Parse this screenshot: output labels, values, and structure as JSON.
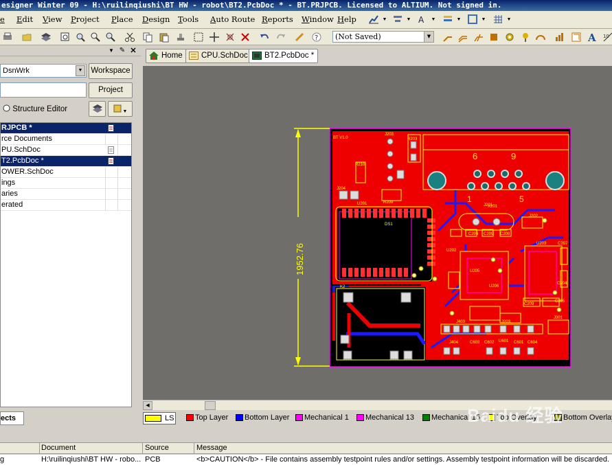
{
  "window": {
    "title": "esigner Winter 09 - H:\\ruilinqiushi\\BT HW - robot\\BT2.PcbDoc * - BT.PRJPCB. Licensed to ALTIUM. Not signed in."
  },
  "menu": {
    "items": [
      "Edit",
      "View",
      "Project",
      "Place",
      "Design",
      "Tools",
      "Auto Route",
      "Reports",
      "Window",
      "Help"
    ],
    "file_fragment": "e"
  },
  "toolbar": {
    "variant_value": "(Not Saved)"
  },
  "left_panel": {
    "workspace_combo": "DsnWrk",
    "workspace_button": "Workspace",
    "project_button": "Project",
    "structure_editor": "Structure Editor",
    "tree": [
      {
        "label": "RJPCB *",
        "state": "selected-bold"
      },
      {
        "label": "rce Documents",
        "state": "normal"
      },
      {
        "label": "PU.SchDoc",
        "state": "normal"
      },
      {
        "label": "T2.PcbDoc *",
        "state": "selected"
      },
      {
        "label": "OWER.SchDoc",
        "state": "normal"
      },
      {
        "label": "ings",
        "state": "normal"
      },
      {
        "label": "aries",
        "state": "normal"
      },
      {
        "label": "erated",
        "state": "normal"
      }
    ],
    "bottom_tab": "ects"
  },
  "doc_tabs": [
    {
      "label": "Home",
      "icon": "home-icon"
    },
    {
      "label": "CPU.SchDoc",
      "icon": "schematic-icon"
    },
    {
      "label": "BT2.PcbDoc *",
      "icon": "pcb-icon"
    }
  ],
  "pcb": {
    "dimension_label": "1952.76",
    "board_text": "BT V1.0",
    "connector_numbers": [
      "6",
      "9",
      "1",
      "5"
    ],
    "designators": [
      "J203",
      "R203",
      "J204",
      "R210",
      "R209",
      "U201",
      "DS1",
      "K2",
      "X201",
      "J202",
      "U202",
      "C206",
      "C209",
      "C208",
      "U203",
      "U205",
      "U206",
      "C204",
      "C205",
      "C207",
      "J201",
      "J301",
      "C209",
      "J403",
      "J404",
      "C603",
      "C602",
      "U601",
      "C601",
      "C604",
      "J203"
    ]
  },
  "layers": [
    {
      "label": "LS",
      "color": "#ffff00"
    },
    {
      "label": "Top Layer",
      "color": "#ff0000"
    },
    {
      "label": "Bottom Layer",
      "color": "#0000ff"
    },
    {
      "label": "Mechanical 1",
      "color": "#ff00ff"
    },
    {
      "label": "Mechanical 13",
      "color": "#ff00ff"
    },
    {
      "label": "Mechanical 15",
      "color": "#008000"
    },
    {
      "label": "Top Overlay",
      "color": "#ffff00"
    },
    {
      "label": "Bottom Overlay",
      "color": "#808000"
    }
  ],
  "messages": {
    "columns": [
      "Document",
      "Source",
      "Message"
    ],
    "row": {
      "class": "g",
      "document": "H:\\ruilinqiushi\\BT HW - robo...",
      "source": "PCB",
      "message": "<b>CAUTION</b> - File contains assembly testpoint rules and/or settings.  Assembly testpoint information will be discarded."
    }
  },
  "watermark": "Baidu 经验"
}
